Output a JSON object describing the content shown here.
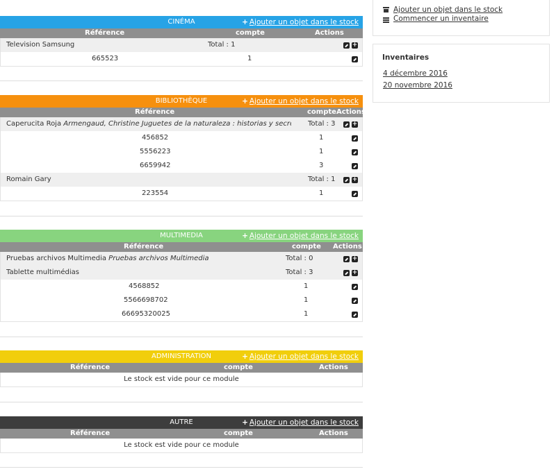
{
  "common": {
    "add_label": "Ajouter un objet dans le stock",
    "col_ref": "Référence",
    "col_count": "compte",
    "col_actions": "Actions",
    "empty_text": "Le stock est vide pour ce module"
  },
  "modules": [
    {
      "title": "CINÉMA",
      "color": "#27a3e6",
      "groups": [
        {
          "name": "Television Samsung",
          "desc": "",
          "total": "Total : 1",
          "items": [
            {
              "ref": "665523",
              "count": "1"
            }
          ]
        }
      ]
    },
    {
      "title": "BIBLIOTHÈQUE",
      "color": "#f6900e",
      "groups": [
        {
          "name": "Caperucita Roja",
          "desc": "Armengaud, Christine Juguetes de la naturaleza : historias y secretos ...",
          "total": "Total : 3",
          "items": [
            {
              "ref": "456852",
              "count": "1"
            },
            {
              "ref": "5556223",
              "count": "1"
            },
            {
              "ref": "6659942",
              "count": "3"
            }
          ]
        },
        {
          "name": "Romain Gary",
          "desc": "",
          "total": "Total : 1",
          "items": [
            {
              "ref": "223554",
              "count": "1"
            }
          ]
        }
      ]
    },
    {
      "title": "MULTIMEDIA",
      "color": "#88d47f",
      "groups": [
        {
          "name": "Pruebas archivos Multimedia",
          "desc": "Pruebas archivos Multimedia",
          "total": "Total : 0",
          "items": []
        },
        {
          "name": "Tablette multimédias",
          "desc": "",
          "total": "Total : 3",
          "items": [
            {
              "ref": "4568852",
              "count": "1"
            },
            {
              "ref": "5566698702",
              "count": "1"
            },
            {
              "ref": "66695320025",
              "count": "1"
            }
          ]
        }
      ]
    },
    {
      "title": "ADMINISTRATION",
      "color": "#f1ce0c",
      "groups": []
    },
    {
      "title": "AUTRE",
      "color": "#3d3d3d",
      "groups": []
    }
  ],
  "sidebar": {
    "actions": [
      {
        "icon": "box-icon",
        "label": "Ajouter un objet dans le stock"
      },
      {
        "icon": "list-icon",
        "label": "Commencer un inventaire"
      }
    ],
    "inventories_title": "Inventaires",
    "inventories": [
      "4 décembre 2016",
      "20 novembre 2016"
    ]
  }
}
